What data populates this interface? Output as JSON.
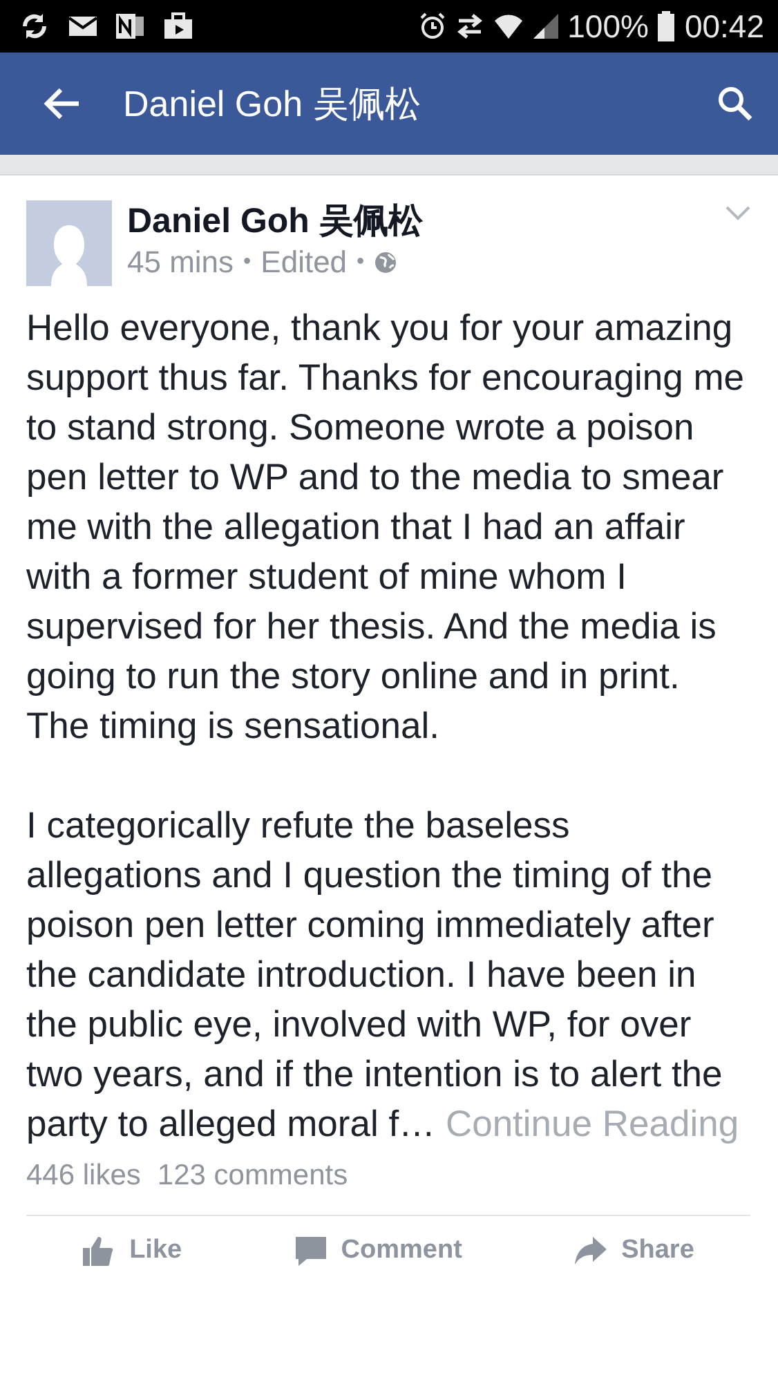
{
  "status_bar": {
    "battery_percent": "100%",
    "time": "00:42"
  },
  "header": {
    "title": "Daniel Goh 吴佩松"
  },
  "post": {
    "author": "Daniel Goh 吴佩松",
    "time": "45 mins",
    "edited": "Edited",
    "separator": "•",
    "paragraphs": [
      "Hello everyone, thank you for your amazing support thus far. Thanks for encouraging me to stand strong. Someone wrote a poison pen letter to WP and to the media to smear me with the allegation that I had an affair with a former student of mine whom I supervised for her thesis. And the media is going to run the story online and in print. The timing is sensational.",
      "I categorically refute the baseless allegations and I question the timing of the poison pen letter coming immediately after the candidate introduction. I have been in the public eye, involved with WP, for over two years, and if the intention is to alert the party to alleged moral f…"
    ],
    "continue_link": "Continue Reading",
    "likes": "446 likes",
    "comments": "123 comments",
    "actions": [
      {
        "kind": "like",
        "label": "Like"
      },
      {
        "kind": "comment",
        "label": "Comment"
      },
      {
        "kind": "share",
        "label": "Share"
      }
    ]
  }
}
